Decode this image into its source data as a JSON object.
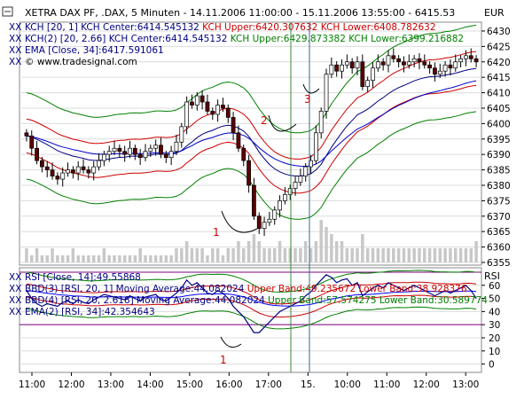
{
  "header": {
    "title": "XETRA DAX PF, .DAX, 5 Minuten - 14.11.2006 11:00:00 - 15.11.2006 13:55:00 - 6415.53",
    "currency": "EUR"
  },
  "price_legend": [
    {
      "parts": [
        {
          "text": "KCH [20, 1] KCH Center:6414.545132 ",
          "color": "#000080"
        },
        {
          "text": "KCH Upper:6420.307632 ",
          "color": "#cc0000"
        },
        {
          "text": "KCH Lower:6408.782632",
          "color": "#cc0000"
        }
      ]
    },
    {
      "parts": [
        {
          "text": "KCH(2) [20, 2.66] KCH Center:6414.545132 ",
          "color": "#000080"
        },
        {
          "text": "KCH Upper:6429.873382 KCH Lower:6399.216882",
          "color": "#008000"
        }
      ]
    },
    {
      "parts": [
        {
          "text": "EMA [Close, 34]:6417.591061",
          "color": "#000080"
        }
      ]
    },
    {
      "parts": [
        {
          "text": "© www.tradesignal.com",
          "color": "#000000"
        }
      ]
    }
  ],
  "rsi_legend": [
    {
      "parts": [
        {
          "text": "RSI [Close, 14]:49.55868",
          "color": "#000080"
        }
      ]
    },
    {
      "parts": [
        {
          "text": "BBD(3) [RSI, 20, 1] Moving Average:44.082024 ",
          "color": "#000080"
        },
        {
          "text": "Upper Band:49.235672 Lower Band:38.928376",
          "color": "#cc0000"
        }
      ]
    },
    {
      "parts": [
        {
          "text": "BBD(4) [RSI, 20, 2.618] Moving Average:44.082024 ",
          "color": "#000080"
        },
        {
          "text": "Upper Band:57.574275 Lower Band:30.589774",
          "color": "#008000"
        }
      ]
    },
    {
      "parts": [
        {
          "text": "EMA(2) [RSI, 34]:42.354643",
          "color": "#000080"
        }
      ]
    }
  ],
  "rsi_label": "RSI",
  "annotations": [
    {
      "text": "1",
      "color": "#cc0000"
    },
    {
      "text": "2",
      "color": "#cc0000"
    },
    {
      "text": "3",
      "color": "#cc0000"
    },
    {
      "text": "1",
      "color": "#cc0000"
    }
  ],
  "x_labels": [
    "11:00",
    "12:00",
    "13:00",
    "14:00",
    "15:00",
    "16:00",
    "17:00",
    "15.",
    "10:00",
    "11:00",
    "12:00",
    "13:00"
  ],
  "chart_data": [
    {
      "type": "candlestick",
      "ylim": [
        6355,
        6432
      ],
      "y_ticks": [
        6355,
        6360,
        6365,
        6370,
        6375,
        6380,
        6385,
        6390,
        6395,
        6400,
        6405,
        6410,
        6415,
        6420,
        6425,
        6430
      ],
      "y_unit": "EUR",
      "grid": true,
      "series": [
        {
          "name": "KCH Upper",
          "color": "#cc0000"
        },
        {
          "name": "KCH Lower",
          "color": "#cc0000"
        },
        {
          "name": "KCH(2) Upper",
          "color": "#008000"
        },
        {
          "name": "KCH(2) Lower",
          "color": "#008000"
        },
        {
          "name": "EMA [Close, 34]",
          "color": "#0000cc"
        }
      ],
      "close": [
        6396,
        6392,
        6388,
        6386,
        6385,
        6383,
        6382,
        6384,
        6385,
        6384,
        6386,
        6385,
        6384,
        6386,
        6388,
        6390,
        6391,
        6392,
        6391,
        6390,
        6392,
        6390,
        6389,
        6391,
        6392,
        6393,
        6390,
        6389,
        6391,
        6394,
        6399,
        6407,
        6406,
        6409,
        6407,
        6404,
        6403,
        6406,
        6405,
        6402,
        6397,
        6392,
        6388,
        6380,
        6370,
        6366,
        6368,
        6369,
        6372,
        6375,
        6377,
        6379,
        6381,
        6383,
        6386,
        6388,
        6397,
        6404,
        6416,
        6419,
        6417,
        6419,
        6420,
        6418,
        6420,
        6412,
        6414,
        6418,
        6420,
        6419,
        6422,
        6421,
        6420,
        6419,
        6420,
        6421,
        6420,
        6419,
        6418,
        6416,
        6417,
        6419,
        6418,
        6420,
        6421,
        6422,
        6421,
        6420
      ],
      "volume": [
        2,
        1,
        2,
        1,
        1,
        2,
        1,
        1,
        1,
        2,
        1,
        1,
        1,
        1,
        1,
        2,
        1,
        1,
        1,
        1,
        1,
        1,
        2,
        1,
        1,
        1,
        1,
        1,
        1,
        2,
        2,
        3,
        2,
        2,
        2,
        1,
        2,
        2,
        1,
        2,
        2,
        3,
        2,
        3,
        4,
        3,
        2,
        2,
        2,
        3,
        2,
        2,
        2,
        2,
        3,
        2,
        3,
        6,
        5,
        4,
        3,
        3,
        2,
        2,
        2,
        4,
        2,
        2,
        2,
        2,
        2,
        2,
        2,
        2,
        2,
        2,
        2,
        2,
        2,
        2,
        2,
        2,
        2,
        2,
        2,
        2,
        2,
        3
      ]
    },
    {
      "type": "line",
      "ylim": [
        -5,
        72
      ],
      "y_ticks": [
        0,
        10,
        20,
        30,
        40,
        50,
        60
      ],
      "y_unit": "RSI",
      "levels": [
        30,
        70
      ],
      "grid": true,
      "series": [
        {
          "name": "RSI [Close, 14]",
          "color": "#000080"
        },
        {
          "name": "BBD(3) Upper Band",
          "color": "#cc0000"
        },
        {
          "name": "BBD(3) Lower Band",
          "color": "#cc0000"
        },
        {
          "name": "BBD(4) Upper Band",
          "color": "#008000"
        },
        {
          "name": "BBD(4) Lower Band",
          "color": "#008000"
        },
        {
          "name": "EMA(2) [RSI, 34]",
          "color": "#0000ff"
        }
      ],
      "rsi": [
        56,
        50,
        46,
        44,
        46,
        45,
        44,
        47,
        48,
        46,
        49,
        47,
        46,
        49,
        51,
        53,
        52,
        51,
        50,
        49,
        52,
        50,
        48,
        51,
        52,
        53,
        49,
        48,
        51,
        54,
        58,
        64,
        60,
        62,
        58,
        54,
        53,
        56,
        54,
        50,
        44,
        40,
        36,
        30,
        24,
        24,
        28,
        32,
        36,
        40,
        42,
        44,
        46,
        48,
        52,
        55,
        60,
        64,
        68,
        66,
        62,
        64,
        65,
        60,
        62,
        52,
        55,
        58,
        60,
        58,
        62,
        60,
        58,
        56,
        58,
        60,
        58,
        56,
        54,
        52,
        54,
        56,
        54,
        56,
        58,
        60,
        56,
        50
      ]
    }
  ]
}
